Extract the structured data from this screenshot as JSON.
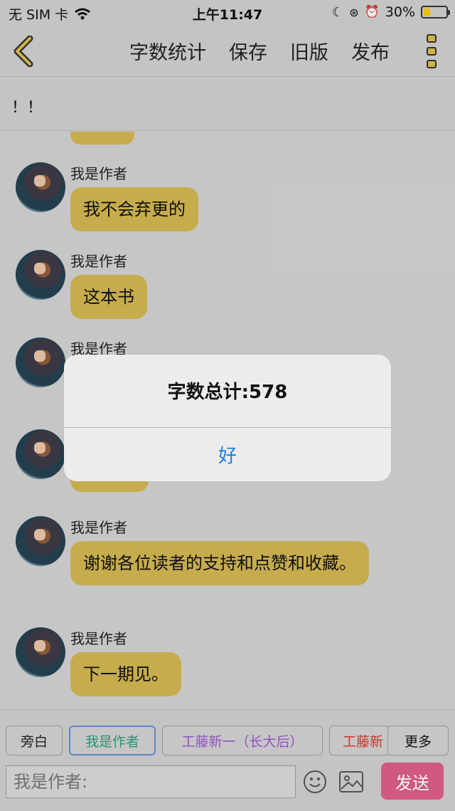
{
  "status_bar": {
    "carrier": "无 SIM 卡",
    "time": "上午11:47",
    "battery_percent": "30%",
    "battery_level": 0.3
  },
  "nav": {
    "actions": [
      "字数统计",
      "保存",
      "旧版",
      "发布"
    ],
    "icons": {
      "back": "chevron-left-icon",
      "more": "vertical-dots-icon"
    }
  },
  "notice": {
    "text": "！！"
  },
  "messages": [
    {
      "sender": "我是作者",
      "text": "我不会弃更的"
    },
    {
      "sender": "我是作者",
      "text": "这本书"
    },
    {
      "sender": "我是作者",
      "text": ""
    },
    {
      "sender": "我是作者",
      "text": ""
    },
    {
      "sender": "我是作者",
      "text": "谢谢各位读者的支持和点赞和收藏。"
    },
    {
      "sender": "我是作者",
      "text": "下一期见。"
    }
  ],
  "composer": {
    "roles": [
      {
        "label": "旁白",
        "color": "#222222"
      },
      {
        "label": "我是作者",
        "color": "#2a9a7a"
      },
      {
        "label": "工藤新一（长大后）",
        "color": "#9a55c8"
      },
      {
        "label": "工藤新",
        "color": "#d03a2a"
      }
    ],
    "more_label": "更多",
    "input_placeholder": "我是作者:",
    "send_label": "发送"
  },
  "dialog": {
    "title": "字数总计:578",
    "ok_label": "好"
  },
  "colors": {
    "bubble": "#cfb451",
    "send_button": "#d95d85",
    "dialog_ok": "#1b7ee0"
  }
}
